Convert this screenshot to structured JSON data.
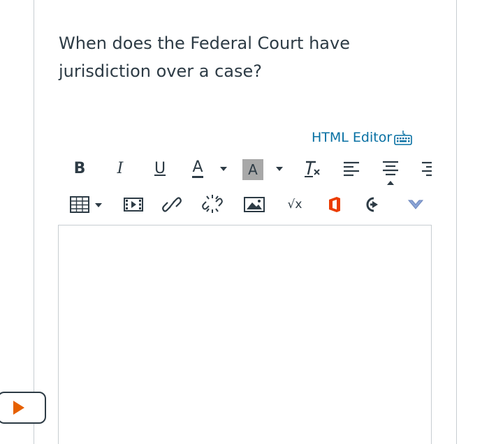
{
  "question": {
    "text": "When does the Federal Court have jurisdiction over a case?"
  },
  "editor": {
    "html_editor_label": "HTML Editor",
    "toolbar": {
      "bold_label": "B",
      "italic_label": "I",
      "underline_label": "U",
      "text_color_label": "A",
      "bg_color_label": "A",
      "sqrt_label": "√x"
    },
    "content": ""
  },
  "colors": {
    "link": "#0770a3",
    "text": "#2d3b45",
    "border": "#c7cdd1",
    "accent_orange": "#e66000",
    "office_red": "#eb3c00",
    "highlight_gray": "#a8a8a8"
  }
}
